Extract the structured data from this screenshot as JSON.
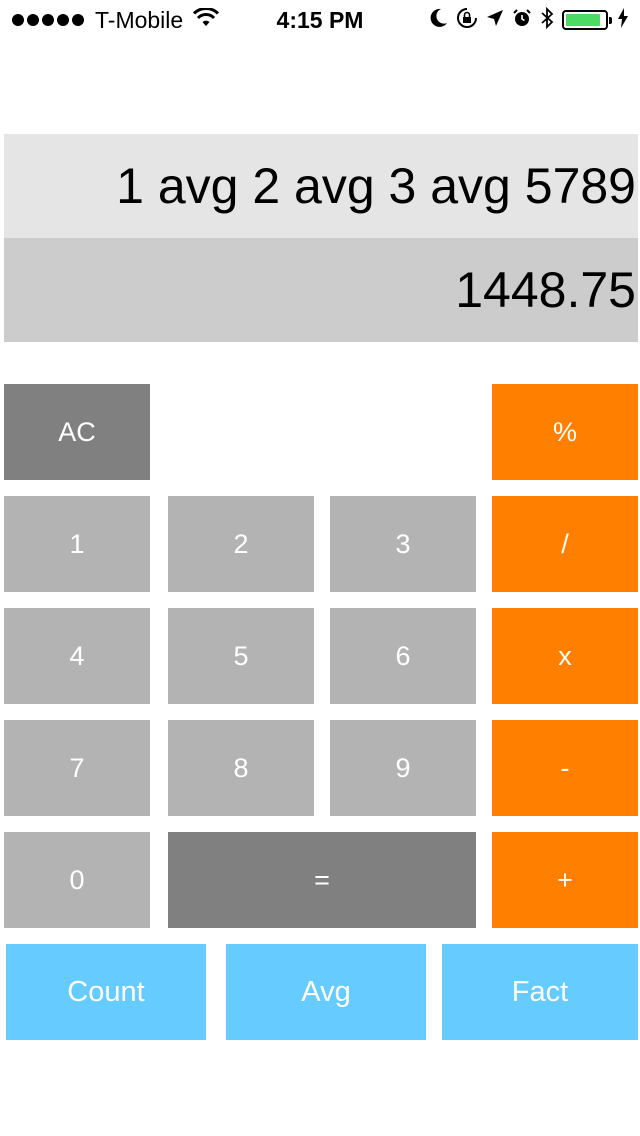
{
  "status_bar": {
    "carrier": "T-Mobile",
    "time": "4:15 PM",
    "battery_level": 0.9,
    "battery_color": "#4cd964",
    "icons": [
      "signal-dots-icon",
      "wifi-icon",
      "moon-icon",
      "orientation-lock-icon",
      "location-arrow-icon",
      "alarm-icon",
      "bluetooth-icon",
      "battery-icon",
      "charging-bolt-icon"
    ]
  },
  "display": {
    "expression": "1 avg 2 avg 3 avg 5789",
    "result": "1448.75"
  },
  "keys": {
    "clear": "AC",
    "percent": "%",
    "divide": "/",
    "multiply": "x",
    "subtract": "-",
    "add": "+",
    "equals": "=",
    "digit_0": "0",
    "digit_1": "1",
    "digit_2": "2",
    "digit_3": "3",
    "digit_4": "4",
    "digit_5": "5",
    "digit_6": "6",
    "digit_7": "7",
    "digit_8": "8",
    "digit_9": "9"
  },
  "functions": {
    "count": "Count",
    "avg": "Avg",
    "fact": "Fact"
  },
  "colors": {
    "operator": "#ff8000",
    "digit": "#b3b3b3",
    "control": "#808080",
    "function": "#66cbff",
    "expression_bg": "#e5e5e5",
    "result_bg": "#cccccc"
  }
}
